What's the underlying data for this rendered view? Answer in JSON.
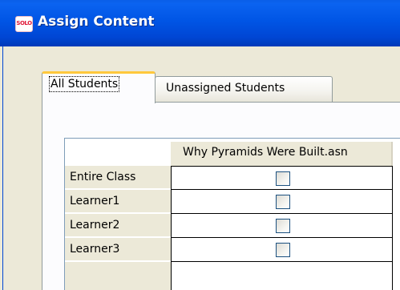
{
  "window": {
    "title": "Assign Content",
    "app_icon_text": "SOLO",
    "accent_color": "#0055e5"
  },
  "tabs": [
    {
      "label": "All Students",
      "active": true
    },
    {
      "label": "Unassigned Students",
      "active": false
    }
  ],
  "grid": {
    "columns": [
      "Why Pyramids Were Built.asn"
    ],
    "rows": [
      {
        "label": "Entire Class",
        "checked": false
      },
      {
        "label": "Learner1",
        "checked": false
      },
      {
        "label": "Learner2",
        "checked": false
      },
      {
        "label": "Learner3",
        "checked": false
      }
    ]
  }
}
